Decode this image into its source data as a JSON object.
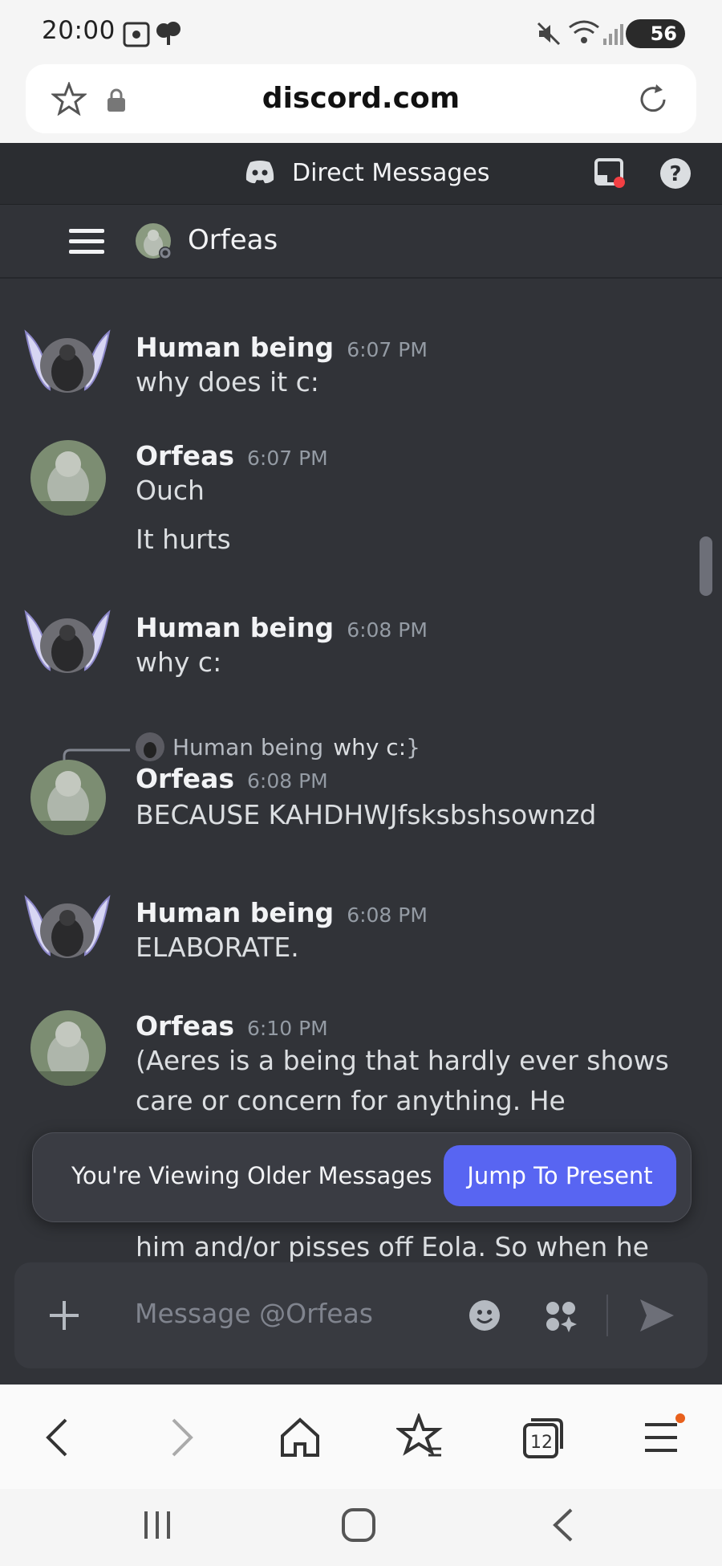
{
  "status_bar": {
    "time": "20:00",
    "battery": "56"
  },
  "browser": {
    "domain": "discord.com",
    "tab_count": "12"
  },
  "discord": {
    "section_title": "Direct Messages",
    "channel_name": "Orfeas",
    "messages": [
      {
        "author": "Human being",
        "time": "6:07 PM",
        "lines": [
          "why does it c:"
        ]
      },
      {
        "author": "Orfeas",
        "time": "6:07 PM",
        "lines": [
          "Ouch",
          "It hurts"
        ]
      },
      {
        "author": "Human being",
        "time": "6:08 PM",
        "lines": [
          "why c:"
        ]
      },
      {
        "reply_author": "Human being",
        "reply_text": "why c:",
        "author": "Orfeas",
        "time": "6:08 PM",
        "lines": [
          "BECAUSE KAHDHWJfsksbshsownzd"
        ]
      },
      {
        "author": "Human being",
        "time": "6:08 PM",
        "lines": [
          "ELABORATE."
        ]
      },
      {
        "author": "Orfeas",
        "time": "6:10 PM",
        "lines": [
          "(Aeres is a being that hardly ever shows",
          "care or concern for anything. He",
          "him and/or pisses off Eola. So when he"
        ]
      }
    ],
    "older_banner": {
      "label": "You're Viewing Older Messages",
      "button": "Jump To Present"
    },
    "composer": {
      "placeholder": "Message @Orfeas"
    }
  },
  "colors": {
    "background": "#313338",
    "accent": "#5865f2",
    "header": "#2b2d31"
  }
}
